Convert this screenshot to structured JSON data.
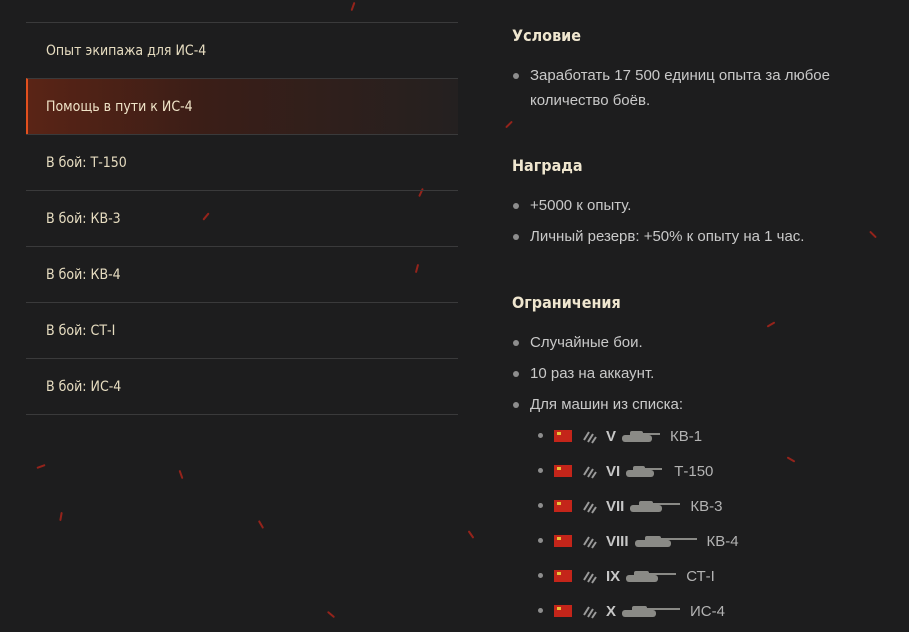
{
  "missions": [
    {
      "label": "Опыт экипажа для ИС-4",
      "active": false
    },
    {
      "label": "Помощь в пути к ИС-4",
      "active": true
    },
    {
      "label": "В бой: Т-150",
      "active": false
    },
    {
      "label": "В бой: КВ-3",
      "active": false
    },
    {
      "label": "В бой: КВ-4",
      "active": false
    },
    {
      "label": "В бой: СТ-I",
      "active": false
    },
    {
      "label": "В бой: ИС-4",
      "active": false
    }
  ],
  "details": {
    "condition": {
      "title": "Условие",
      "items": [
        "Заработать 17 500 единиц опыта за любое количество боёв."
      ]
    },
    "reward": {
      "title": "Награда",
      "items": [
        "+5000 к опыту.",
        "Личный резерв: +50% к опыту на 1 час."
      ]
    },
    "restrictions": {
      "title": "Ограничения",
      "items": [
        "Случайные бои.",
        "10 раз на аккаунт.",
        "Для машин из списка:"
      ]
    },
    "vehicles": [
      {
        "tier": "V",
        "name": "КВ-1",
        "nation_icon": "ussr-flag-icon",
        "class_icon": "heavy-tank-class-icon"
      },
      {
        "tier": "VI",
        "name": "Т-150",
        "nation_icon": "ussr-flag-icon",
        "class_icon": "heavy-tank-class-icon"
      },
      {
        "tier": "VII",
        "name": "КВ-3",
        "nation_icon": "ussr-flag-icon",
        "class_icon": "heavy-tank-class-icon"
      },
      {
        "tier": "VIII",
        "name": "КВ-4",
        "nation_icon": "ussr-flag-icon",
        "class_icon": "heavy-tank-class-icon"
      },
      {
        "tier": "IX",
        "name": "СТ-I",
        "nation_icon": "ussr-flag-icon",
        "class_icon": "heavy-tank-class-icon"
      },
      {
        "tier": "X",
        "name": "ИС-4",
        "nation_icon": "ussr-flag-icon",
        "class_icon": "heavy-tank-class-icon"
      }
    ]
  },
  "colors": {
    "background": "#1d1d1e",
    "active_accent": "#e2501e",
    "heading": "#efe6cf",
    "list_text": "#e6dcc0"
  }
}
